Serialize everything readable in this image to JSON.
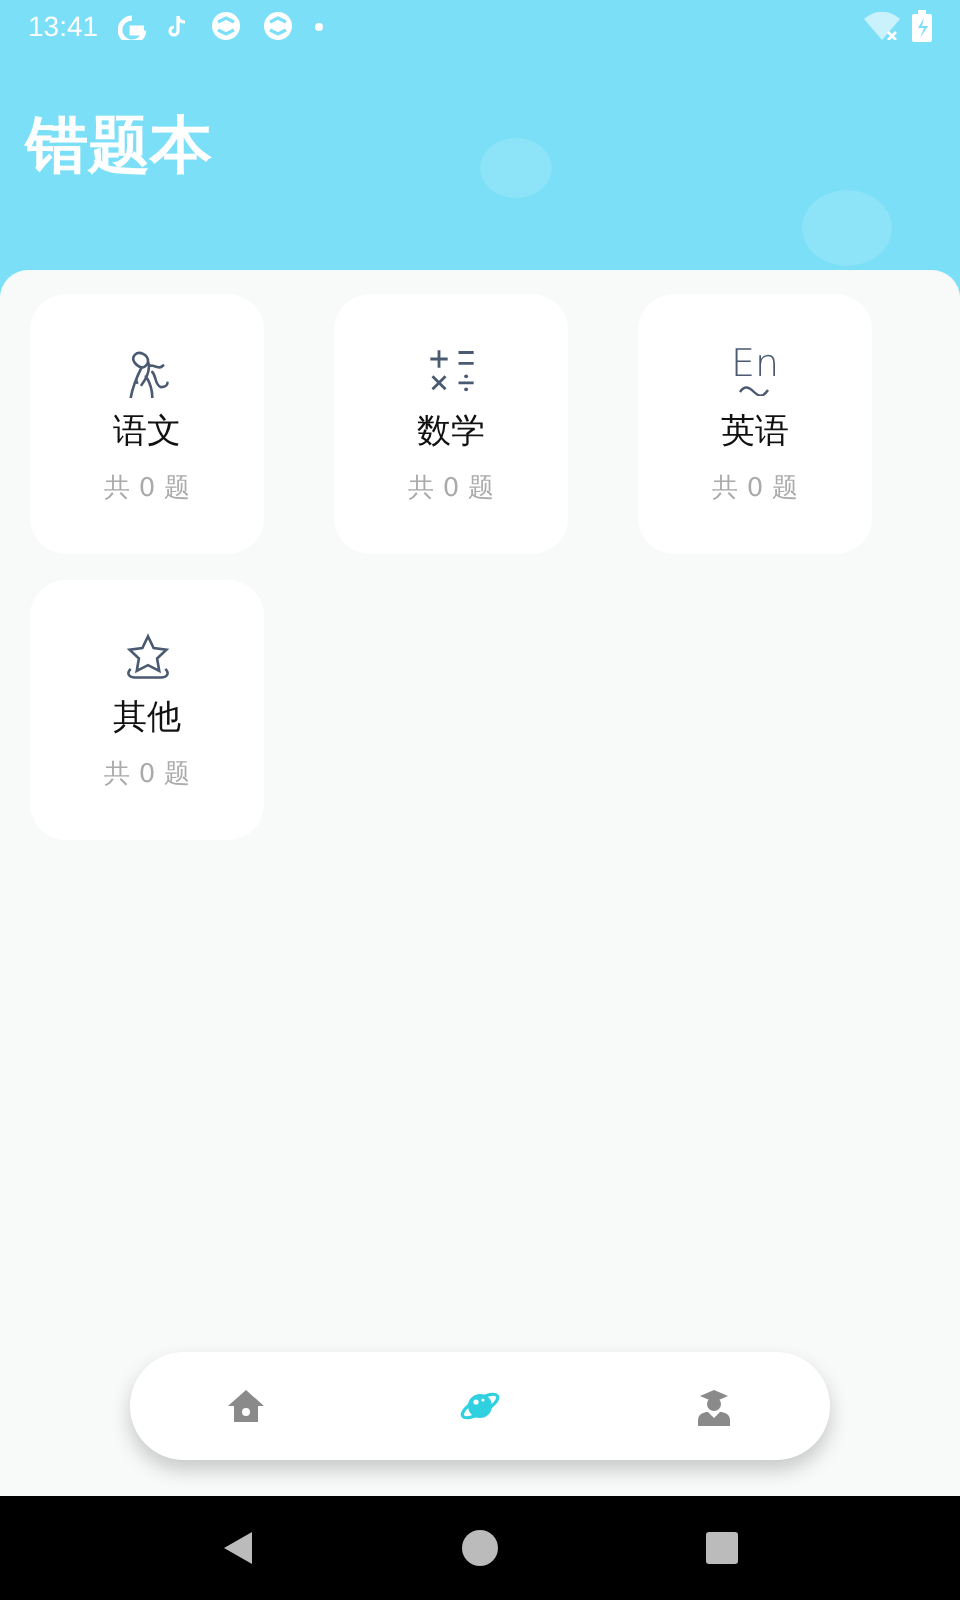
{
  "status_bar": {
    "time": "13:41"
  },
  "header": {
    "title": "错题本"
  },
  "subjects": [
    {
      "kind": "literature",
      "name": "语文",
      "count": "共 0 题"
    },
    {
      "kind": "math",
      "name": "数学",
      "count": "共 0 题"
    },
    {
      "kind": "english",
      "icon_text": "En",
      "name": "英语",
      "count": "共 0 题"
    },
    {
      "kind": "other",
      "name": "其他",
      "count": "共 0 题"
    }
  ],
  "bottom_nav": [
    {
      "kind": "home",
      "selected": false
    },
    {
      "kind": "planet",
      "selected": true
    },
    {
      "kind": "profile",
      "selected": false
    }
  ]
}
